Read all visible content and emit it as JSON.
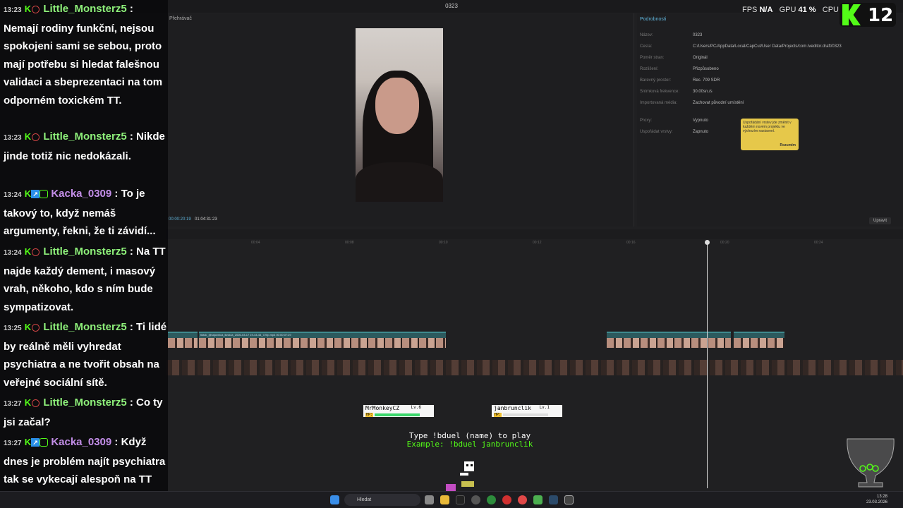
{
  "editor": {
    "window_title": "0323",
    "player": {
      "header": "Přehrávač",
      "current_time": "00:00:20:19",
      "total_time": "01:04:31:23"
    },
    "details": {
      "header": "Podrobnosti",
      "rows": [
        {
          "label": "Název:",
          "value": "0323"
        },
        {
          "label": "Cesta:",
          "value": "C:/Users/PC/AppData/Local/CapCut/User Data/Projects/com.lveditor.draft/0323"
        },
        {
          "label": "Poměr stran:",
          "value": "Originál"
        },
        {
          "label": "Rozlišení:",
          "value": "Přizpůsobeno"
        },
        {
          "label": "Barevný prostor:",
          "value": "Rec. 709 SDR"
        },
        {
          "label": "Snímková frekvence:",
          "value": "30.00sn./s"
        },
        {
          "label": "Importovaná média:",
          "value": "Zachovat původní umístění"
        },
        {
          "label": "Proxy:",
          "value": "Vypnuto"
        },
        {
          "label": "Uspořádat vrstvy:",
          "value": "Zapnuto"
        }
      ],
      "tooltip_text": "Uspořádání vrstev jde změnit v každém novém projektu ve výchozím nastavení.",
      "tooltip_button": "Rozumím",
      "edit_button": "Upravit"
    },
    "timeline": {
      "ruler_ticks": [
        "00:04",
        "00:08",
        "00:10",
        "00:12",
        "00:16",
        "00:20",
        "00:24"
      ],
      "clip_label": "tiktok_@kajovnica_lisvtica_2026-03-17 19-44-44_720p.mp4  00:00:07:29"
    }
  },
  "stats": {
    "fps_label": "FPS",
    "fps_value": "N/A",
    "gpu_label": "GPU",
    "gpu_value": "41 %",
    "cpu_label": "CPU",
    "viewer_count": "12"
  },
  "chat": {
    "messages": [
      {
        "time": "13:23",
        "user": "Little_Monsterz5",
        "user_color": "#8ef07a",
        "text": "Nemají rodiny funkční, nejsou spokojeni sami se sebou, proto mají potřebu si hledat falešnou validaci a sbeprezentaci na tom odporném toxickém TT.",
        "hide_header": true
      },
      {
        "time": "13:23",
        "user": "Little_Monsterz5",
        "user_color": "#8ef07a",
        "text": "Nikde jinde totiž nic nedokázali."
      },
      {
        "time": "13:24",
        "user": "Kacka_0309",
        "user_color": "#c38ee8",
        "text": "To je takový to, když nemáš argumenty, řekni, že ti závidí..."
      },
      {
        "time": "13:24",
        "user": "Little_Monsterz5",
        "user_color": "#8ef07a",
        "text": "Na TT najde každý dement, i masový vrah, někoho, kdo s ním bude sympatizovat."
      },
      {
        "time": "13:25",
        "user": "Little_Monsterz5",
        "user_color": "#8ef07a",
        "text": "Ti lidé by reálně měli vyhredat psychiatra a ne tvořit obsah na veřejné sociální sítě."
      },
      {
        "time": "13:27",
        "user": "Little_Monsterz5",
        "user_color": "#8ef07a",
        "text": "Co ty jsi začal?"
      },
      {
        "time": "13:27",
        "user": "Kacka_0309",
        "user_color": "#c38ee8",
        "text": "Když dnes je problém najít psychiatra tak se vykecají alespoň na TT"
      }
    ]
  },
  "duel": {
    "player1_name": "MrMonkeyCZ",
    "player1_level": "Lv.6",
    "player2_name": "janbrunclik",
    "player2_level": "Lv.1",
    "hp_label": "HP:",
    "player1_hp": 1.0,
    "player2_hp": 0.0,
    "instruction": "Type !bduel (name) to play",
    "example": "Example: !bduel janbrunclik"
  },
  "taskbar": {
    "search_placeholder": "Hledat",
    "time": "13:28",
    "date": "23.03.2026"
  }
}
